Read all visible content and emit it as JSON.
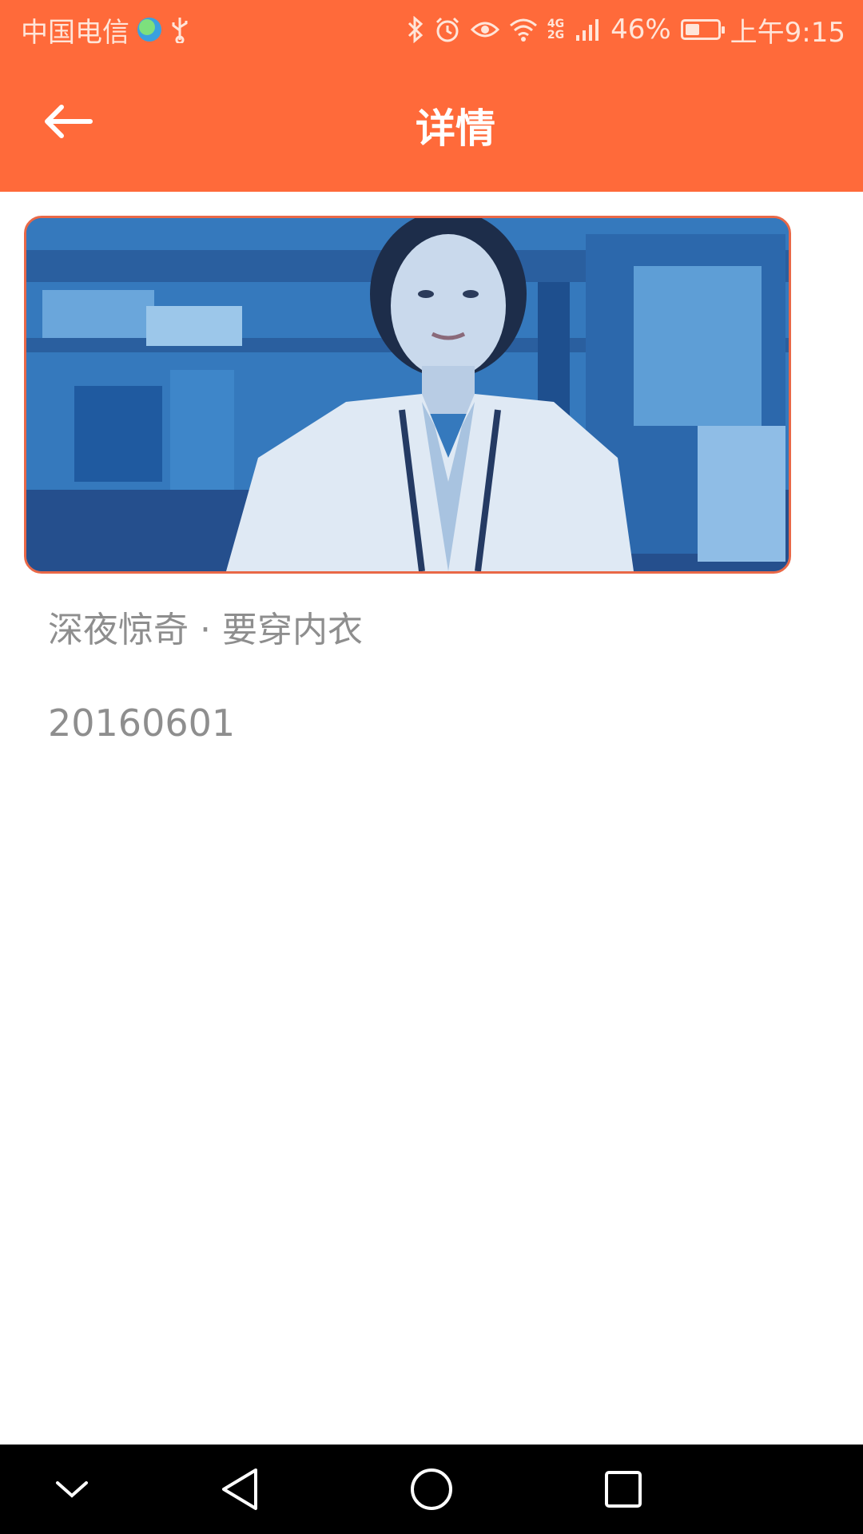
{
  "status_bar": {
    "carrier": "中国电信",
    "network_top": "4G",
    "network_bottom": "2G",
    "battery_percent": "46%",
    "battery_level": 0.46,
    "time": "上午9:15"
  },
  "app_bar": {
    "title": "详情",
    "back_icon": "back-arrow-icon"
  },
  "article": {
    "title": "深夜惊奇 · 要穿内衣",
    "date": "20160601"
  },
  "nav_bar": {
    "icons": [
      "chevron-down-icon",
      "back-triangle-icon",
      "home-circle-icon",
      "recents-square-icon"
    ]
  },
  "colors": {
    "accent": "#ff6a3a",
    "text_secondary": "#8e8e8e",
    "image_border": "#e96847"
  }
}
